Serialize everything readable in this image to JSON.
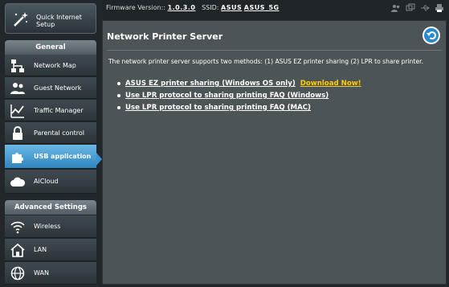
{
  "sidebar": {
    "quick_setup": "Quick Internet\nSetup",
    "general_header": "General",
    "general_items": [
      {
        "label": "Network Map",
        "icon": "network-map-icon"
      },
      {
        "label": "Guest Network",
        "icon": "guest-network-icon"
      },
      {
        "label": "Traffic Manager",
        "icon": "traffic-manager-icon"
      },
      {
        "label": "Parental control",
        "icon": "lock-icon"
      },
      {
        "label": "USB application",
        "icon": "puzzle-icon"
      },
      {
        "label": "AiCloud",
        "icon": "cloud-icon"
      }
    ],
    "advanced_header": "Advanced Settings",
    "advanced_items": [
      {
        "label": "Wireless",
        "icon": "wireless-icon"
      },
      {
        "label": "LAN",
        "icon": "home-icon"
      },
      {
        "label": "WAN",
        "icon": "globe-icon"
      }
    ],
    "active": "USB application"
  },
  "topbar": {
    "firmware_label": "Firmware Version::",
    "firmware_value": "1.0.3.0",
    "ssid_label": "SSID:",
    "ssid_1": "ASUS",
    "ssid_2": "ASUS_5G"
  },
  "main": {
    "title": "Network Printer Server",
    "description": "The network printer server supports two methods: (1) ASUS EZ printer sharing (2) LPR to share printer.",
    "links": [
      {
        "text": "ASUS EZ printer sharing (Windows OS only)",
        "extra": "Download Now!"
      },
      {
        "text": "Use LPR protocol to sharing printing FAQ (Windows)"
      },
      {
        "text": "Use LPR protocol to sharing printing FAQ (MAC)"
      }
    ]
  },
  "colors": {
    "accent": "#2e86c1",
    "highlight": "#ffcc00"
  }
}
